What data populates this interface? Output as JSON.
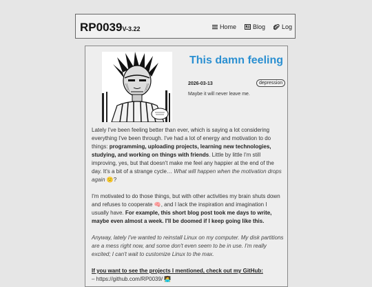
{
  "header": {
    "brand": "RP0039",
    "version": "V-3.22",
    "nav": [
      {
        "label": "Home",
        "icon": "menu-icon"
      },
      {
        "label": "Blog",
        "icon": "newspaper-icon"
      },
      {
        "label": "Log",
        "icon": "paperclip-icon"
      }
    ]
  },
  "post": {
    "title": "This damn feeling",
    "date": "2026-03-13",
    "tag": "depression",
    "subtitle": "Maybe it will never leave me.",
    "p1_a": "Lately I've been feeling better than ever, which is saying a lot considering everything I've been through. I've had a lot of energy and motivation to do things: ",
    "p1_b": "programming, uploading projects, learning new technologies, studying, and working on things with friends",
    "p1_c": ". Little by little I'm still improving, yes, but that doesn't make me feel any happier at the end of the day. It's a bit of a strange cycle… ",
    "p1_d": "What will happen when the motivation drops again",
    "p1_emoji": "😕",
    "p1_e": "?",
    "p2_a": "I'm motivated to do those things, but with other activities my brain shuts down and refuses to cooperate ",
    "p2_emoji": "🧠",
    "p2_b": ", and I lack the inspiration and imagination I usually have. ",
    "p2_c": "For example, this short blog post took me days to write, maybe even almost a week. I'll be doomed if I keep going like this.",
    "p3": "Anyway, lately I've wanted to reinstall Linux on my computer. My disk partitions are a mess right now, and some don't even seem to be in use. I'm really excited; I can't wait to customize Linux to the max.",
    "p4_link": "If you want to see the projects I mentioned, check out my GitHub:",
    "p4_url": "– https://github.com/RP0039/",
    "p4_emoji": "🧑‍💻"
  }
}
